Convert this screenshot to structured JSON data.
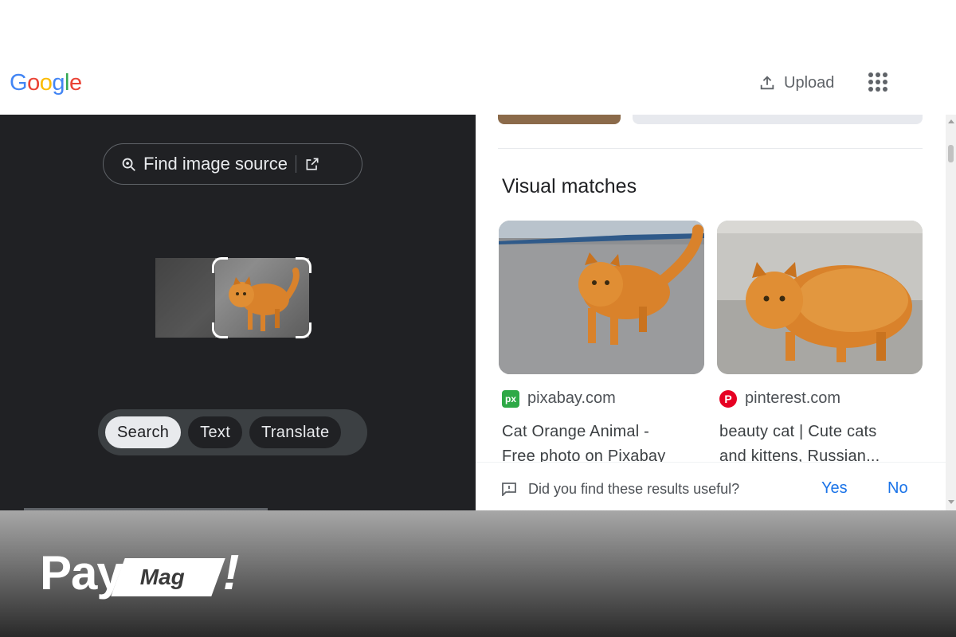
{
  "header": {
    "logo": "Google",
    "logo_colors": [
      "#4285F4",
      "#EA4335",
      "#FBBC05",
      "#4285F4",
      "#34A853",
      "#EA4335"
    ],
    "upload_label": "Upload",
    "upload_icon": "upload-icon",
    "apps_icon": "apps-grid-icon"
  },
  "left_pane": {
    "find_source_label": "Find image source",
    "find_source_icon": "lens-search-icon",
    "external_icon": "open-in-new-icon",
    "modes": [
      {
        "label": "Search",
        "active": true
      },
      {
        "label": "Text",
        "active": false
      },
      {
        "label": "Translate",
        "active": false
      }
    ]
  },
  "results": {
    "section_title": "Visual matches",
    "items": [
      {
        "source": "pixabay.com",
        "favicon_text": "px",
        "favicon_color": "#2ea946",
        "title_line1": "Cat Orange Animal -",
        "title_line2": "Free photo on Pixabay"
      },
      {
        "source": "pinterest.com",
        "favicon_text": "P",
        "favicon_color": "#e60023",
        "title_line1": "beauty cat | Cute cats",
        "title_line2": "and kittens, Russian..."
      }
    ],
    "feedback": {
      "question": "Did you find these results useful?",
      "yes": "Yes",
      "no": "No"
    }
  },
  "banner": {
    "pay": "Pay",
    "mag": "Mag",
    "bang": "!"
  },
  "colors": {
    "dark_bg": "#202124",
    "link_blue": "#1a73e8",
    "cat_orange": "#d9822b"
  }
}
